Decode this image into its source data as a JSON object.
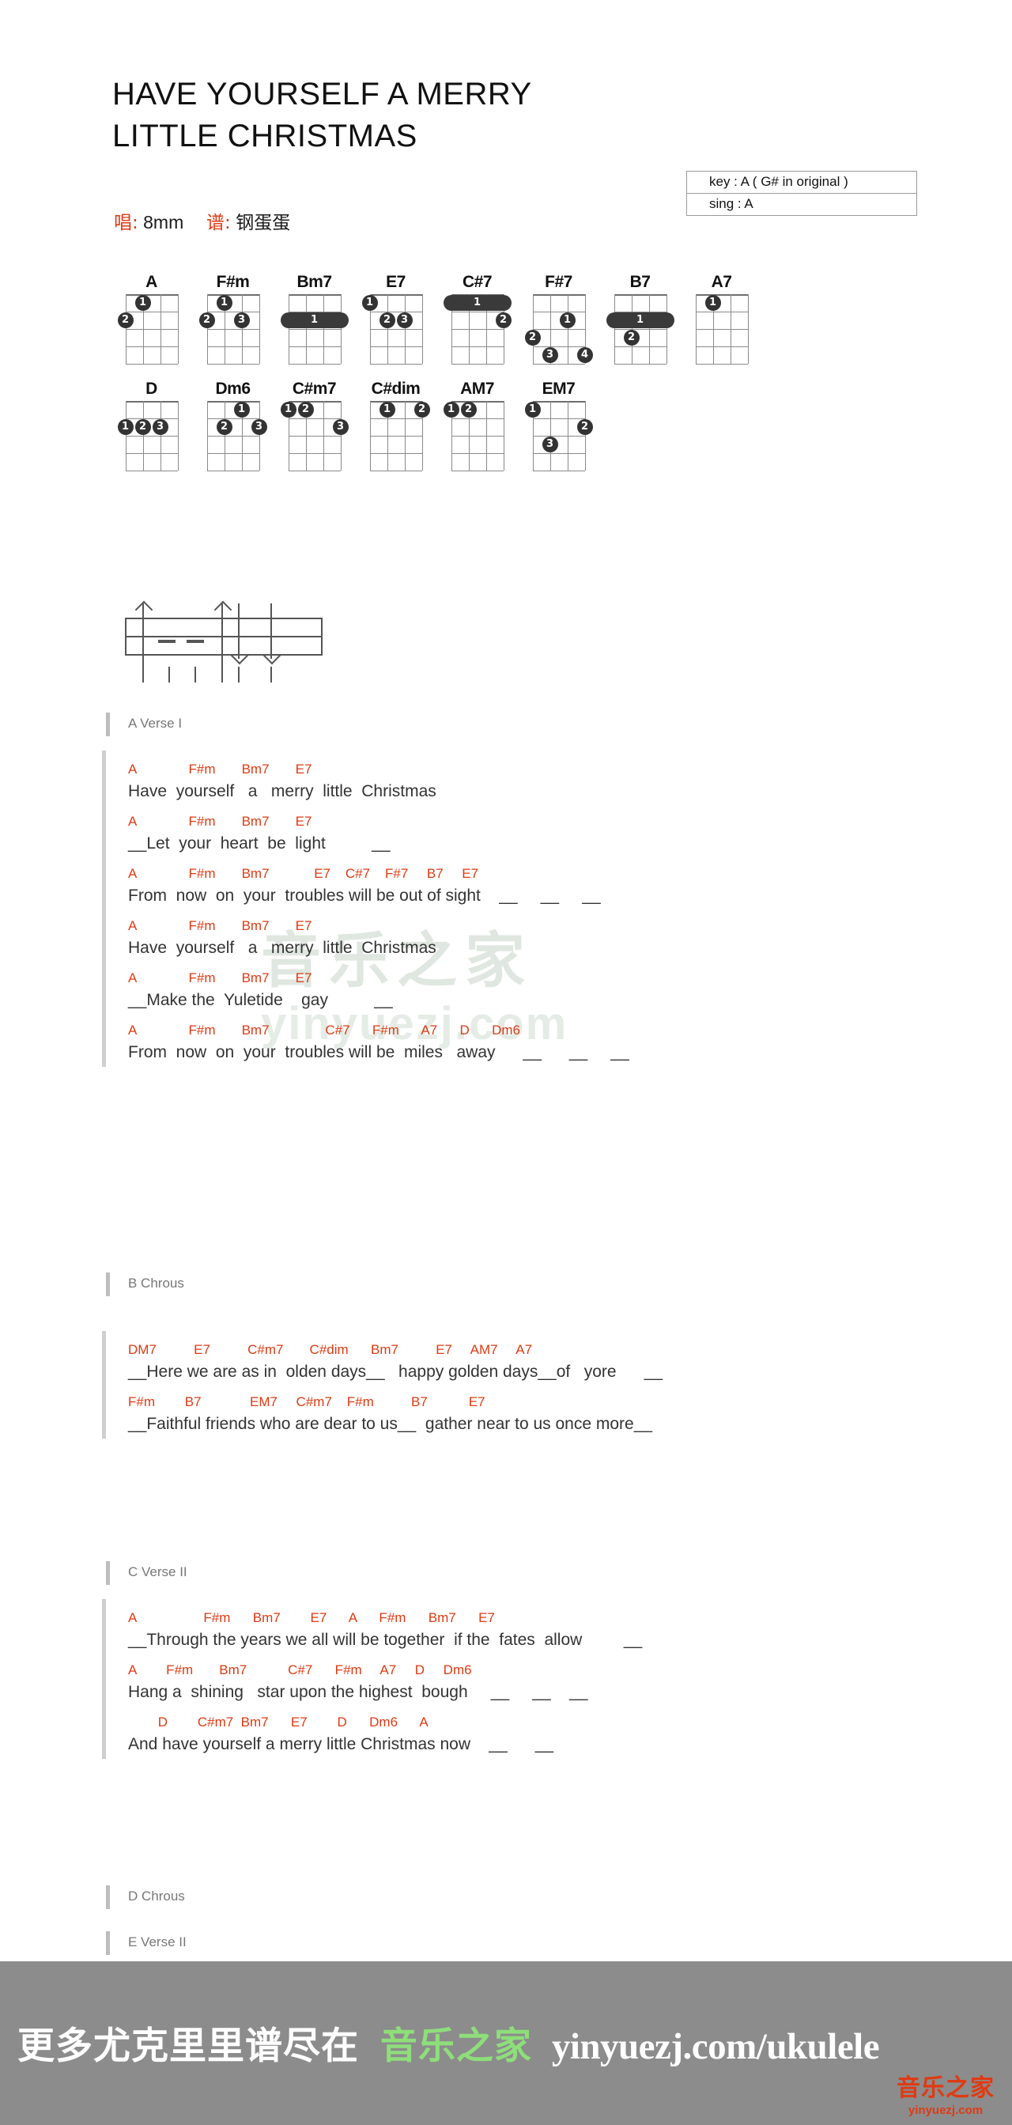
{
  "title": "HAVE YOURSELF A MERRY\nLITTLE CHRISTMAS",
  "byline": {
    "sing_label": "唱:",
    "sing_value": "8mm",
    "tab_label": "谱:",
    "tab_value": "钢蛋蛋"
  },
  "keybox": {
    "key": "key : A ( G# in original )",
    "sing": "sing : A"
  },
  "colors": {
    "chord_red": "#e03a13",
    "lyric_gray": "#333333",
    "section_gray": "#777777",
    "footer_bg": "#8c8c8c",
    "footer_green": "#8ede7a"
  },
  "watermark": {
    "line1": "音乐之家",
    "line2": "yinyuezj.com"
  },
  "chord_diagrams": {
    "row1": [
      {
        "name": "A",
        "dots": [
          {
            "s": 2,
            "f": 1,
            "n": "1"
          },
          {
            "s": 1,
            "f": 2,
            "n": "2"
          }
        ],
        "bars": []
      },
      {
        "name": "F#m",
        "dots": [
          {
            "s": 2,
            "f": 1,
            "n": "1"
          },
          {
            "s": 1,
            "f": 2,
            "n": "2"
          },
          {
            "s": 3,
            "f": 2,
            "n": "3"
          }
        ],
        "bars": []
      },
      {
        "name": "Bm7",
        "dots": [],
        "bars": [
          {
            "f": 2,
            "from": 1,
            "to": 4,
            "n": "1"
          }
        ]
      },
      {
        "name": "E7",
        "dots": [
          {
            "s": 1,
            "f": 1,
            "n": "1"
          },
          {
            "s": 2,
            "f": 2,
            "n": "2"
          },
          {
            "s": 3,
            "f": 2,
            "n": "3"
          }
        ],
        "bars": []
      },
      {
        "name": "C#7",
        "dots": [
          {
            "s": 4,
            "f": 2,
            "n": "2"
          }
        ],
        "bars": [
          {
            "f": 1,
            "from": 1,
            "to": 4,
            "n": "1"
          }
        ]
      },
      {
        "name": "F#7",
        "dots": [
          {
            "s": 3,
            "f": 2,
            "n": "1"
          },
          {
            "s": 1,
            "f": 3,
            "n": "2"
          },
          {
            "s": 2,
            "f": 4,
            "n": "3"
          },
          {
            "s": 4,
            "f": 4,
            "n": "4"
          }
        ],
        "bars": []
      },
      {
        "name": "B7",
        "dots": [
          {
            "s": 2,
            "f": 3,
            "n": "2"
          }
        ],
        "bars": [
          {
            "f": 2,
            "from": 1,
            "to": 4,
            "n": "1"
          }
        ]
      },
      {
        "name": "A7",
        "dots": [
          {
            "s": 2,
            "f": 1,
            "n": "1"
          }
        ],
        "bars": []
      }
    ],
    "row2": [
      {
        "name": "D",
        "dots": [
          {
            "s": 1,
            "f": 2,
            "n": "1"
          },
          {
            "s": 2,
            "f": 2,
            "n": "2"
          },
          {
            "s": 3,
            "f": 2,
            "n": "3"
          }
        ],
        "bars": []
      },
      {
        "name": "Dm6",
        "dots": [
          {
            "s": 3,
            "f": 1,
            "n": "1"
          },
          {
            "s": 2,
            "f": 2,
            "n": "2"
          },
          {
            "s": 4,
            "f": 2,
            "n": "3"
          }
        ],
        "bars": []
      },
      {
        "name": "C#m7",
        "dots": [
          {
            "s": 1,
            "f": 1,
            "n": "1"
          },
          {
            "s": 2,
            "f": 1,
            "n": "2"
          },
          {
            "s": 4,
            "f": 2,
            "n": "3"
          }
        ],
        "bars": []
      },
      {
        "name": "C#dim",
        "dots": [
          {
            "s": 2,
            "f": 1,
            "n": "1"
          },
          {
            "s": 4,
            "f": 1,
            "n": "2"
          }
        ],
        "bars": []
      },
      {
        "name": "AM7",
        "dots": [
          {
            "s": 1,
            "f": 1,
            "n": "1"
          },
          {
            "s": 2,
            "f": 1,
            "n": "2"
          }
        ],
        "bars": []
      },
      {
        "name": "EM7",
        "dots": [
          {
            "s": 1,
            "f": 1,
            "n": "1"
          },
          {
            "s": 4,
            "f": 2,
            "n": "2"
          },
          {
            "s": 2,
            "f": 3,
            "n": "3"
          }
        ],
        "bars": []
      }
    ]
  },
  "sections": [
    {
      "label": "A Verse I",
      "lines": [
        {
          "chords": "A              F#m       Bm7       E7",
          "lyrics": "Have  yourself   a   merry  little  Christmas"
        },
        {
          "chords": "A              F#m       Bm7       E7",
          "lyrics": "__Let  your  heart  be  light          __"
        },
        {
          "chords": "A              F#m       Bm7            E7    C#7    F#7     B7     E7",
          "lyrics": "From  now  on  your  troubles will be out of sight    __     __     __"
        },
        {
          "chords": "A              F#m       Bm7       E7",
          "lyrics": "Have  yourself   a   merry  little  Christmas"
        },
        {
          "chords": "A              F#m       Bm7       E7",
          "lyrics": "__Make the  Yuletide    gay          __"
        },
        {
          "chords": "A              F#m       Bm7               C#7      F#m      A7      D      Dm6",
          "lyrics": "From  now  on  your  troubles will be  miles   away      __      __     __"
        }
      ]
    },
    {
      "label": "B Chrous",
      "lines": [
        {
          "chords": "DM7          E7          C#m7       C#dim      Bm7          E7     AM7     A7",
          "lyrics": "__Here we are as in  olden days__   happy golden days__of   yore      __"
        },
        {
          "chords": "F#m        B7             EM7     C#m7    F#m          B7           E7",
          "lyrics": "__Faithful friends who are dear to us__  gather near to us once more__"
        }
      ]
    },
    {
      "label": "C Verse II",
      "lines": [
        {
          "chords": "A                  F#m      Bm7        E7      A      F#m      Bm7      E7",
          "lyrics": "__Through the years we all will be together  if the  fates  allow         __"
        },
        {
          "chords": "A        F#m       Bm7           C#7      F#m     A7     D     Dm6",
          "lyrics": "Hang a  shining   star upon the highest  bough     __     __    __"
        },
        {
          "chords": "        D        C#m7  Bm7      E7        D      Dm6      A",
          "lyrics": "And have yourself a merry little Christmas now    __      __"
        }
      ]
    },
    {
      "label": "D Chrous",
      "lines": []
    },
    {
      "label": "E Verse II",
      "lines": []
    }
  ],
  "footer": {
    "cn": "更多尤克里里谱尽在",
    "brand": "音乐之家",
    "url": "yinyuezj.com/ukulele",
    "logo_cn": "音乐之家",
    "logo_url": "yinyuezj.com"
  }
}
